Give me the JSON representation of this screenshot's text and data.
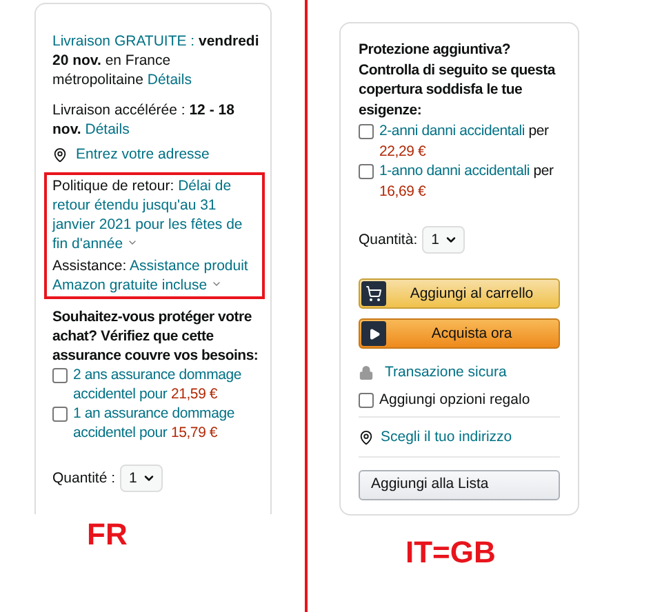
{
  "left_panel": {
    "delivery": [
      {
        "lead_link": "Livraison GRATUITE :",
        "text": "**vendredi 20 nov.** en France métropolitaine",
        "link": "Détails"
      },
      {
        "text": "Livraison accélérée : **12 - 18 nov.**",
        "link": "Détails"
      }
    ],
    "address_link": "Entrez votre adresse",
    "policies": [
      {
        "label": "Politique de retour:",
        "value": "Délai de retour étendu jusqu'au 31 janvier 2021 pour les fêtes de fin d'année"
      },
      {
        "label": "Assistance:",
        "value": "Assistance produit Amazon gratuite incluse"
      }
    ],
    "protection_prompt": "Souhaitez-vous protéger votre achat? Vérifiez que cette assurance couvre vos besoins:",
    "options": [
      {
        "checked": false,
        "text": "2 ans assurance dommage accidentel pour",
        "price": "21,59 €"
      },
      {
        "checked": false,
        "text": "1 an assurance dommage accidentel pour",
        "price": "15,79 €"
      }
    ],
    "quantity": {
      "label": "Quantité :",
      "value": "1"
    }
  },
  "left_caption": "FR",
  "right_panel": {
    "protection_prompt": "Protezione aggiuntiva? Controlla di seguito se questa copertura soddisfa le tue esigenze:",
    "options": [
      {
        "checked": false,
        "text": "2-anni danni accidentali",
        "connector": "per",
        "price": "22,29 €"
      },
      {
        "checked": false,
        "text": "1-anno danni accidentali",
        "connector": "per",
        "price": "16,69 €"
      }
    ],
    "quantity": {
      "label": "Quantità:",
      "value": "1"
    },
    "buttons": [
      {
        "kind": "cart",
        "label": "Aggiungi al carrello"
      },
      {
        "kind": "buy",
        "label": "Acquista ora"
      }
    ],
    "secure_transaction": "Transazione sicura",
    "gift_option": {
      "label": "Aggiungi opzioni regalo",
      "checked": false
    },
    "address_link": "Scegli il tuo indirizzo",
    "list_button": "Aggiungi alla Lista"
  },
  "right_caption": "IT=GB"
}
